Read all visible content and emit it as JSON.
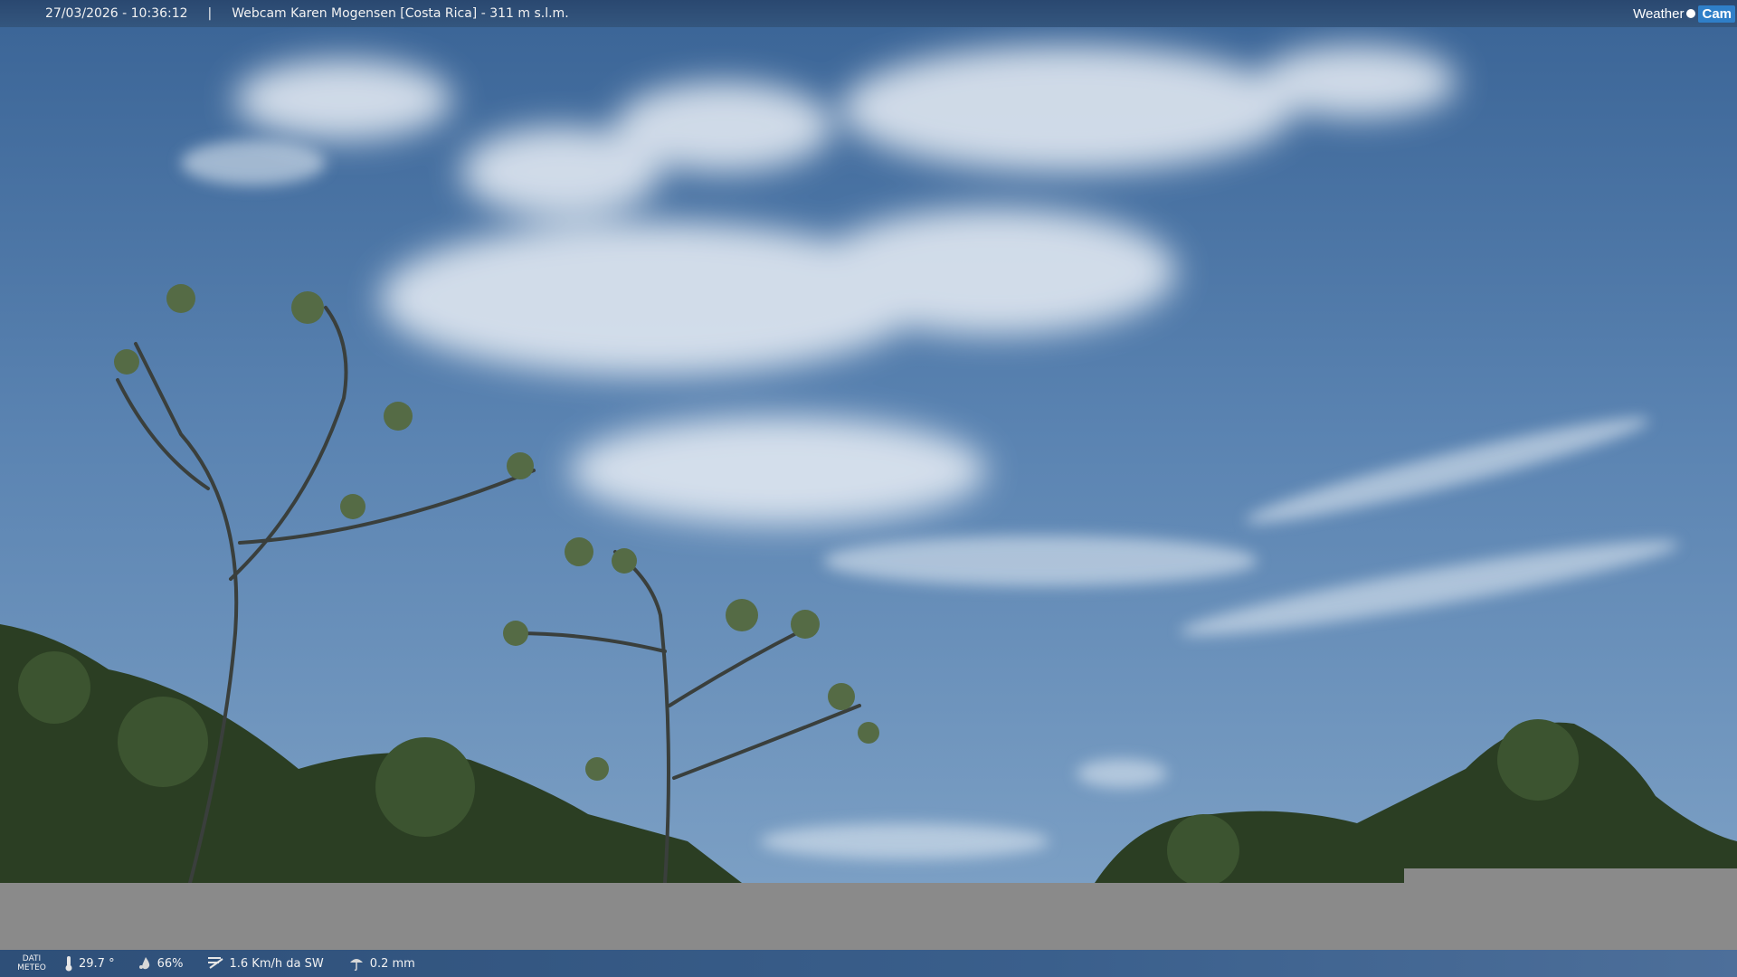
{
  "header": {
    "datetime": "27/03/2026 - 10:36:12",
    "separator": "|",
    "title": "Webcam Karen Mogensen [Costa Rica] - 311 m s.l.m."
  },
  "brand": {
    "part1": "Weather",
    "part2": "Cam"
  },
  "footer": {
    "label_line1": "DATI",
    "label_line2": "METEO",
    "temperature": "29.7 °",
    "humidity": "66%",
    "wind": "1.6 Km/h da SW",
    "rain": "0.2 mm",
    "icons": [
      "thermometer-icon",
      "humidity-drop-icon",
      "wind-icon",
      "rain-icon"
    ]
  },
  "colors": {
    "sky": "#3f6e9f",
    "bar": "#2e4f78",
    "gray": "#8a8a8a"
  }
}
